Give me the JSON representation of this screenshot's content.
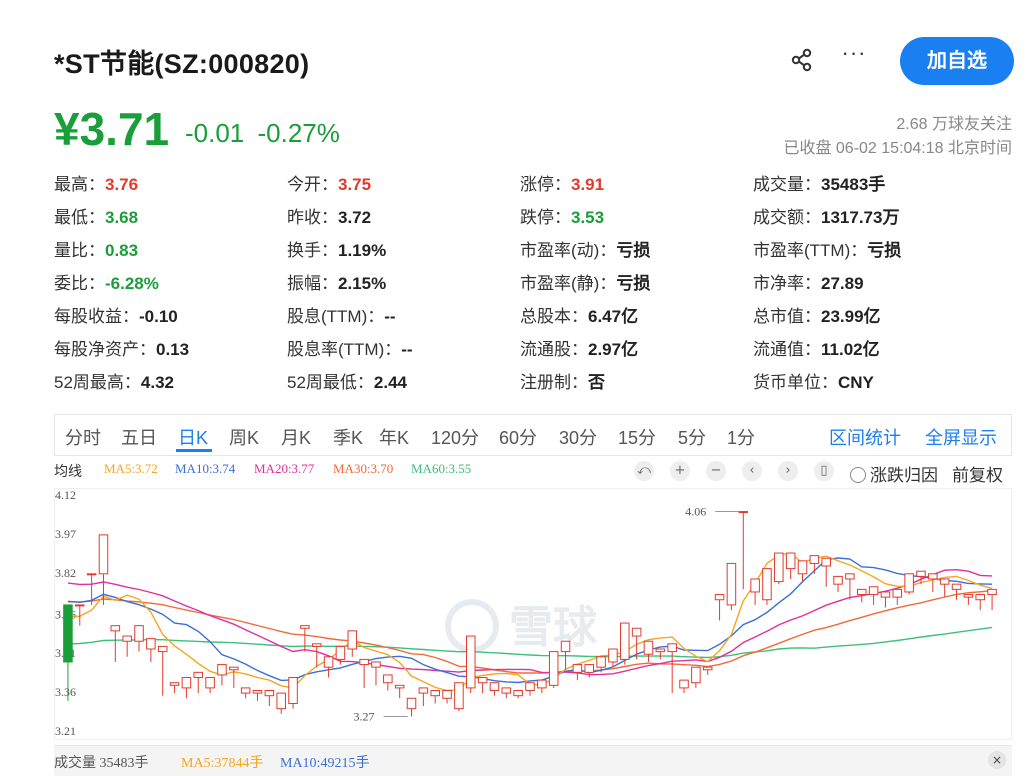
{
  "header": {
    "title": "*ST节能(SZ:000820)",
    "more_label": "···",
    "follow_label": "加自选"
  },
  "price": {
    "current": "¥3.71",
    "change": "-0.01",
    "change_pct": "-0.27%",
    "followers": "2.68 万球友关注",
    "status": "已收盘 06-02 15:04:18 北京时间"
  },
  "quote_rows": [
    [
      {
        "label": "最高：",
        "value": "3.76",
        "tone": "up"
      },
      {
        "label": "今开：",
        "value": "3.75",
        "tone": "up"
      },
      {
        "label": "涨停：",
        "value": "3.91",
        "tone": "up"
      },
      {
        "label": "成交量：",
        "value": "35483手",
        "tone": "neutral"
      }
    ],
    [
      {
        "label": "最低：",
        "value": "3.68",
        "tone": "down"
      },
      {
        "label": "昨收：",
        "value": "3.72",
        "tone": "neutral"
      },
      {
        "label": "跌停：",
        "value": "3.53",
        "tone": "down"
      },
      {
        "label": "成交额：",
        "value": "1317.73万",
        "tone": "neutral"
      }
    ],
    [
      {
        "label": "量比：",
        "value": "0.83",
        "tone": "down"
      },
      {
        "label": "换手：",
        "value": "1.19%",
        "tone": "neutral"
      },
      {
        "label": "市盈率(动)：",
        "value": "亏损",
        "tone": "neutral"
      },
      {
        "label": "市盈率(TTM)：",
        "value": "亏损",
        "tone": "neutral"
      }
    ],
    [
      {
        "label": "委比：",
        "value": "-6.28%",
        "tone": "down"
      },
      {
        "label": "振幅：",
        "value": "2.15%",
        "tone": "neutral"
      },
      {
        "label": "市盈率(静)：",
        "value": "亏损",
        "tone": "neutral"
      },
      {
        "label": "市净率：",
        "value": "27.89",
        "tone": "neutral"
      }
    ],
    [
      {
        "label": "每股收益：",
        "value": "-0.10",
        "tone": "neutral"
      },
      {
        "label": "股息(TTM)：",
        "value": "--",
        "tone": "neutral"
      },
      {
        "label": "总股本：",
        "value": "6.47亿",
        "tone": "neutral"
      },
      {
        "label": "总市值：",
        "value": "23.99亿",
        "tone": "neutral"
      }
    ],
    [
      {
        "label": "每股净资产：",
        "value": "0.13",
        "tone": "neutral"
      },
      {
        "label": "股息率(TTM)：",
        "value": "--",
        "tone": "neutral"
      },
      {
        "label": "流通股：",
        "value": "2.97亿",
        "tone": "neutral"
      },
      {
        "label": "流通值：",
        "value": "11.02亿",
        "tone": "neutral"
      }
    ],
    [
      {
        "label": "52周最高：",
        "value": "4.32",
        "tone": "neutral"
      },
      {
        "label": "52周最低：",
        "value": "2.44",
        "tone": "neutral"
      },
      {
        "label": "注册制：",
        "value": "否",
        "tone": "neutral"
      },
      {
        "label": "货币单位：",
        "value": "CNY",
        "tone": "neutral"
      }
    ]
  ],
  "tabs": {
    "items": [
      "分时",
      "五日",
      "日K",
      "周K",
      "月K",
      "季K",
      "年K",
      "120分",
      "60分",
      "30分",
      "15分",
      "5分",
      "1分"
    ],
    "active": "日K",
    "range_stats": "区间统计",
    "fullscreen": "全屏显示"
  },
  "ma_legend": {
    "avg_label": "均线",
    "ma5": "MA5:3.72",
    "ma10": "MA10:3.74",
    "ma20": "MA20:3.77",
    "ma30": "MA30:3.70",
    "ma60": "MA60:3.55",
    "ma5_color": "#f5a623",
    "ma10_color": "#3a6fd8",
    "ma20_color": "#e0309e",
    "ma30_color": "#f06a3a",
    "ma60_color": "#3fc07a"
  },
  "controls": {
    "undo_icon": "⤺",
    "zoom_in_icon": "+",
    "zoom_out_icon": "−",
    "prev_icon": "‹",
    "next_icon": "›",
    "candle_icon": "▯",
    "limit_attribution": "涨跌归因",
    "adjust": "前复权"
  },
  "volume": {
    "label": "成交量 35483手",
    "ma5": "MA5:37844手",
    "ma10": "MA10:49215手",
    "close_icon": "×"
  },
  "chart_data": {
    "type": "candlestick",
    "y_ticks": [
      "4.12",
      "3.97",
      "3.82",
      "3.66",
      "3.51",
      "3.36",
      "3.21"
    ],
    "ylim": [
      3.21,
      4.12
    ],
    "up_color": "#e33a2c",
    "down_color": "#1a9e3a",
    "annotations": [
      {
        "text": "4.06",
        "index": 57,
        "price": 4.06
      },
      {
        "text": "3.27",
        "index": 29,
        "price": 3.27
      }
    ],
    "candles": [
      [
        3.7,
        3.48,
        3.33,
        3.48
      ],
      [
        3.7,
        3.7,
        3.62,
        3.63
      ],
      [
        3.82,
        3.82,
        3.7,
        3.82
      ],
      [
        3.82,
        3.97,
        3.7,
        3.7
      ],
      [
        3.6,
        3.62,
        3.48,
        3.53
      ],
      [
        3.56,
        3.58,
        3.5,
        3.52
      ],
      [
        3.56,
        3.62,
        3.52,
        3.55
      ],
      [
        3.53,
        3.57,
        3.48,
        3.52
      ],
      [
        3.52,
        3.54,
        3.35,
        3.38
      ],
      [
        3.39,
        3.4,
        3.36,
        3.39
      ],
      [
        3.38,
        3.42,
        3.34,
        3.36
      ],
      [
        3.42,
        3.44,
        3.36,
        3.37
      ],
      [
        3.38,
        3.42,
        3.36,
        3.4
      ],
      [
        3.43,
        3.47,
        3.39,
        3.46
      ],
      [
        3.45,
        3.46,
        3.38,
        3.39
      ],
      [
        3.36,
        3.38,
        3.34,
        3.35
      ],
      [
        3.36,
        3.37,
        3.33,
        3.34
      ],
      [
        3.35,
        3.37,
        3.31,
        3.33
      ],
      [
        3.3,
        3.36,
        3.28,
        3.35
      ],
      [
        3.32,
        3.42,
        3.3,
        3.4
      ],
      [
        3.61,
        3.62,
        3.52,
        3.54
      ],
      [
        3.54,
        3.55,
        3.46,
        3.48
      ],
      [
        3.46,
        3.5,
        3.42,
        3.5
      ],
      [
        3.49,
        3.54,
        3.47,
        3.52
      ],
      [
        3.53,
        3.6,
        3.5,
        3.53
      ],
      [
        3.47,
        3.49,
        3.38,
        3.42
      ],
      [
        3.46,
        3.48,
        3.39,
        3.41
      ],
      [
        3.4,
        3.43,
        3.37,
        3.39
      ],
      [
        3.38,
        3.39,
        3.34,
        3.35
      ],
      [
        3.3,
        3.34,
        3.27,
        3.33
      ],
      [
        3.36,
        3.38,
        3.31,
        3.34
      ],
      [
        3.35,
        3.37,
        3.32,
        3.36
      ],
      [
        3.34,
        3.37,
        3.32,
        3.36
      ],
      [
        3.3,
        3.4,
        3.29,
        3.38
      ],
      [
        3.38,
        3.58,
        3.36,
        3.4
      ],
      [
        3.4,
        3.42,
        3.36,
        3.37
      ],
      [
        3.37,
        3.4,
        3.35,
        3.39
      ],
      [
        3.36,
        3.38,
        3.34,
        3.37
      ],
      [
        3.35,
        3.37,
        3.34,
        3.36
      ],
      [
        3.37,
        3.4,
        3.35,
        3.39
      ],
      [
        3.38,
        3.41,
        3.36,
        3.4
      ],
      [
        3.39,
        3.52,
        3.38,
        3.5
      ],
      [
        3.52,
        3.56,
        3.45,
        3.47
      ],
      [
        3.44,
        3.47,
        3.41,
        3.43
      ],
      [
        3.44,
        3.47,
        3.42,
        3.46
      ],
      [
        3.46,
        3.5,
        3.44,
        3.49
      ],
      [
        3.48,
        3.53,
        3.46,
        3.5
      ],
      [
        3.49,
        3.63,
        3.47,
        3.6
      ],
      [
        3.58,
        3.61,
        3.49,
        3.52
      ],
      [
        3.51,
        3.56,
        3.48,
        3.55
      ],
      [
        3.52,
        3.53,
        3.49,
        3.51
      ],
      [
        3.52,
        3.55,
        3.36,
        3.39
      ],
      [
        3.38,
        3.41,
        3.36,
        3.4
      ],
      [
        3.4,
        3.46,
        3.38,
        3.44
      ],
      [
        3.45,
        3.46,
        3.43,
        3.45
      ],
      [
        3.72,
        3.74,
        3.64,
        3.65
      ],
      [
        3.7,
        3.86,
        3.68,
        3.84
      ],
      [
        4.06,
        4.06,
        3.76,
        3.76
      ],
      [
        3.75,
        3.8,
        3.7,
        3.73
      ],
      [
        3.72,
        3.84,
        3.7,
        3.81
      ],
      [
        3.79,
        3.9,
        3.78,
        3.82
      ],
      [
        3.84,
        3.9,
        3.8,
        3.83
      ],
      [
        3.82,
        3.87,
        3.79,
        3.84
      ],
      [
        3.86,
        3.89,
        3.82,
        3.85
      ],
      [
        3.85,
        3.88,
        3.77,
        3.79
      ],
      [
        3.78,
        3.81,
        3.75,
        3.76
      ],
      [
        3.8,
        3.82,
        3.72,
        3.74
      ],
      [
        3.74,
        3.76,
        3.71,
        3.72
      ],
      [
        3.74,
        3.77,
        3.7,
        3.71
      ],
      [
        3.73,
        3.75,
        3.69,
        3.72
      ],
      [
        3.73,
        3.76,
        3.7,
        3.71
      ],
      [
        3.75,
        3.82,
        3.74,
        3.8
      ],
      [
        3.81,
        3.83,
        3.78,
        3.79
      ],
      [
        3.8,
        3.82,
        3.75,
        3.76
      ],
      [
        3.78,
        3.8,
        3.73,
        3.74
      ],
      [
        3.76,
        3.78,
        3.72,
        3.73
      ],
      [
        3.73,
        3.74,
        3.7,
        3.71
      ],
      [
        3.72,
        3.74,
        3.68,
        3.73
      ],
      [
        3.74,
        3.76,
        3.68,
        3.71
      ]
    ]
  }
}
